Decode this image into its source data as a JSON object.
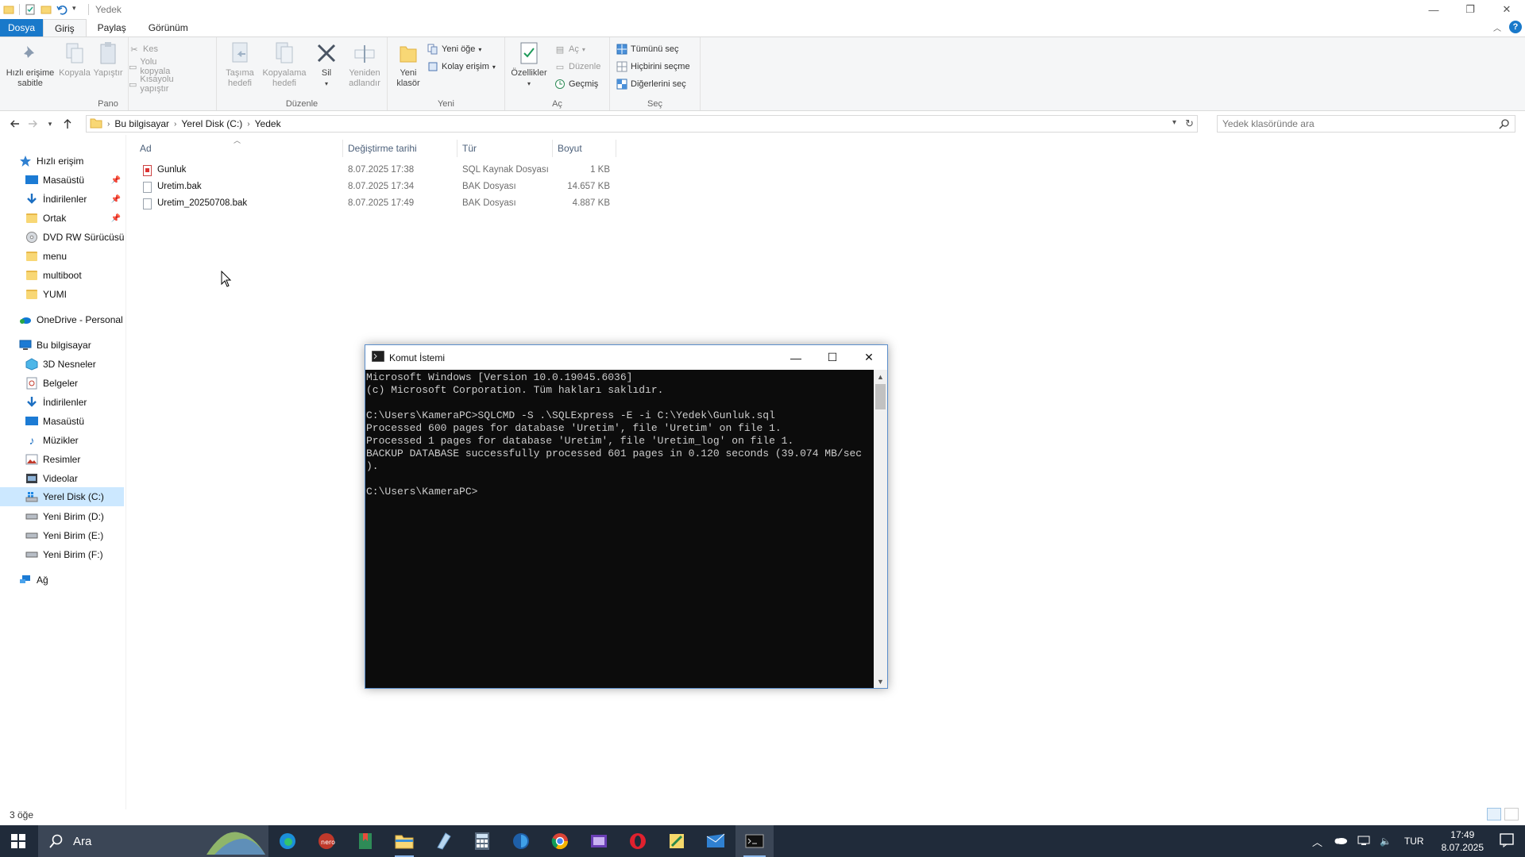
{
  "window": {
    "title": "Yedek"
  },
  "ribbon_tabs": [
    "Dosya",
    "Giriş",
    "Paylaş",
    "Görünüm"
  ],
  "ribbon": {
    "pano": {
      "label": "Pano",
      "pin": "Hızlı erişime sabitle",
      "pin_l1": "Hızlı erişime",
      "pin_l2": "sabitle",
      "copy": "Kopyala",
      "paste": "Yapıştır",
      "cut": "Kes",
      "copy_path": "Yolu kopyala",
      "paste_shortcut": "Kısayolu yapıştır"
    },
    "duzenle": {
      "label": "Düzenle",
      "move_l1": "Taşıma",
      "move_l2": "hedefi",
      "copyto_l1": "Kopyalama",
      "copyto_l2": "hedefi",
      "delete": "Sil",
      "rename_l1": "Yeniden",
      "rename_l2": "adlandır"
    },
    "yeni": {
      "label": "Yeni",
      "new_folder_l1": "Yeni",
      "new_folder_l2": "klasör",
      "new_item": "Yeni öğe",
      "easy_access": "Kolay erişim"
    },
    "ac": {
      "label": "Aç",
      "properties": "Özellikler",
      "open": "Aç",
      "edit": "Düzenle",
      "history": "Geçmiş"
    },
    "sec": {
      "label": "Seç",
      "select_all": "Tümünü seç",
      "select_none": "Hiçbirini seçme",
      "invert": "Diğerlerini seç"
    }
  },
  "address": {
    "crumbs": [
      "Bu bilgisayar",
      "Yerel Disk (C:)",
      "Yedek"
    ],
    "search_placeholder": "Yedek klasöründe ara"
  },
  "nav": {
    "quick_access": "Hızlı erişim",
    "quick_items": [
      "Masaüstü",
      "İndirilenler",
      "Ortak",
      "DVD RW Sürücüsü (",
      "menu",
      "multiboot",
      "YUMI"
    ],
    "onedrive": "OneDrive - Personal",
    "this_pc": "Bu bilgisayar",
    "pc_items": [
      "3D Nesneler",
      "Belgeler",
      "İndirilenler",
      "Masaüstü",
      "Müzikler",
      "Resimler",
      "Videolar",
      "Yerel Disk (C:)",
      "Yeni Birim (D:)",
      "Yeni Birim (E:)",
      "Yeni Birim (F:)"
    ],
    "network": "Ağ"
  },
  "columns": [
    "Ad",
    "Değiştirme tarihi",
    "Tür",
    "Boyut"
  ],
  "files": [
    {
      "name": "Gunluk",
      "date": "8.07.2025 17:38",
      "type": "SQL Kaynak Dosyası",
      "size": "1 KB"
    },
    {
      "name": "Uretim.bak",
      "date": "8.07.2025 17:34",
      "type": "BAK Dosyası",
      "size": "14.657 KB"
    },
    {
      "name": "Uretim_20250708.bak",
      "date": "8.07.2025 17:49",
      "type": "BAK Dosyası",
      "size": "4.887 KB"
    }
  ],
  "status": {
    "count": "3 öğe"
  },
  "cmd": {
    "title": "Komut İstemi",
    "lines": [
      "Microsoft Windows [Version 10.0.19045.6036]",
      "(c) Microsoft Corporation. Tüm hakları saklıdır.",
      "",
      "C:\\Users\\KameraPC>SQLCMD -S .\\SQLExpress -E -i C:\\Yedek\\Gunluk.sql",
      "Processed 600 pages for database 'Uretim', file 'Uretim' on file 1.",
      "Processed 1 pages for database 'Uretim', file 'Uretim_log' on file 1.",
      "BACKUP DATABASE successfully processed 601 pages in 0.120 seconds (39.074 MB/sec",
      ").",
      "",
      "C:\\Users\\KameraPC>"
    ]
  },
  "taskbar": {
    "search_label": "Ara",
    "lang": "TUR",
    "time": "17:49",
    "date": "8.07.2025"
  },
  "colors": {
    "accent": "#1979ca",
    "selection": "#cce8ff",
    "taskbar": "#202b3a",
    "console_bg": "#0c0c0c",
    "console_text": "#cccccc"
  }
}
